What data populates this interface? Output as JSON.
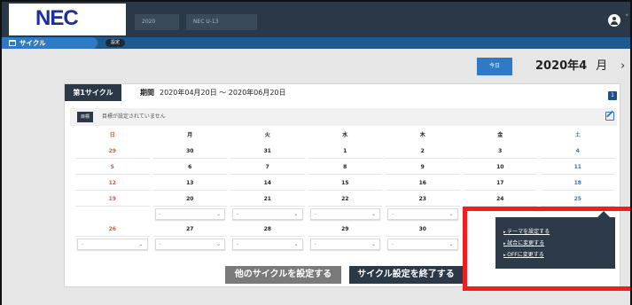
{
  "header": {
    "logo_text": "NEC",
    "select1": "2020",
    "select2": "NEC U-13"
  },
  "subnav": {
    "cycle_tab": "サイクル",
    "setting_chip": "設定"
  },
  "toolbar": {
    "today_label": "今日",
    "month": "2020年4",
    "month_unit": "月",
    "next": "›"
  },
  "cycle": {
    "label": "第1サイクル",
    "period_key": "期間",
    "period_value": "2020年04月20日 ～ 2020年06月20日",
    "info_badge": "1"
  },
  "goal": {
    "chip": "目標",
    "text": "目標が設定されていません"
  },
  "calendar": {
    "weekdays": [
      "日",
      "月",
      "火",
      "水",
      "木",
      "金",
      "土"
    ],
    "weekday_colors": [
      "#e8542a",
      "#222222",
      "#222222",
      "#222222",
      "#222222",
      "#222222",
      "#2f7ac4"
    ],
    "weeks": [
      [
        "29",
        "30",
        "31",
        "1",
        "2",
        "3",
        "4"
      ],
      [
        "5",
        "6",
        "7",
        "8",
        "9",
        "10",
        "11"
      ],
      [
        "12",
        "13",
        "14",
        "15",
        "16",
        "17",
        "18"
      ],
      [
        "19",
        "20",
        "21",
        "22",
        "23",
        "24",
        "25"
      ],
      [
        "26",
        "27",
        "28",
        "29",
        "30",
        "",
        ""
      ]
    ],
    "dropdown_placeholder": "-"
  },
  "popover": {
    "items": [
      "テーマを設定する",
      "試合に変更する",
      "OFFに変更する"
    ]
  },
  "actions": {
    "other_cycle": "他のサイクルを設定する",
    "end_setting": "サイクル設定を終了する"
  }
}
